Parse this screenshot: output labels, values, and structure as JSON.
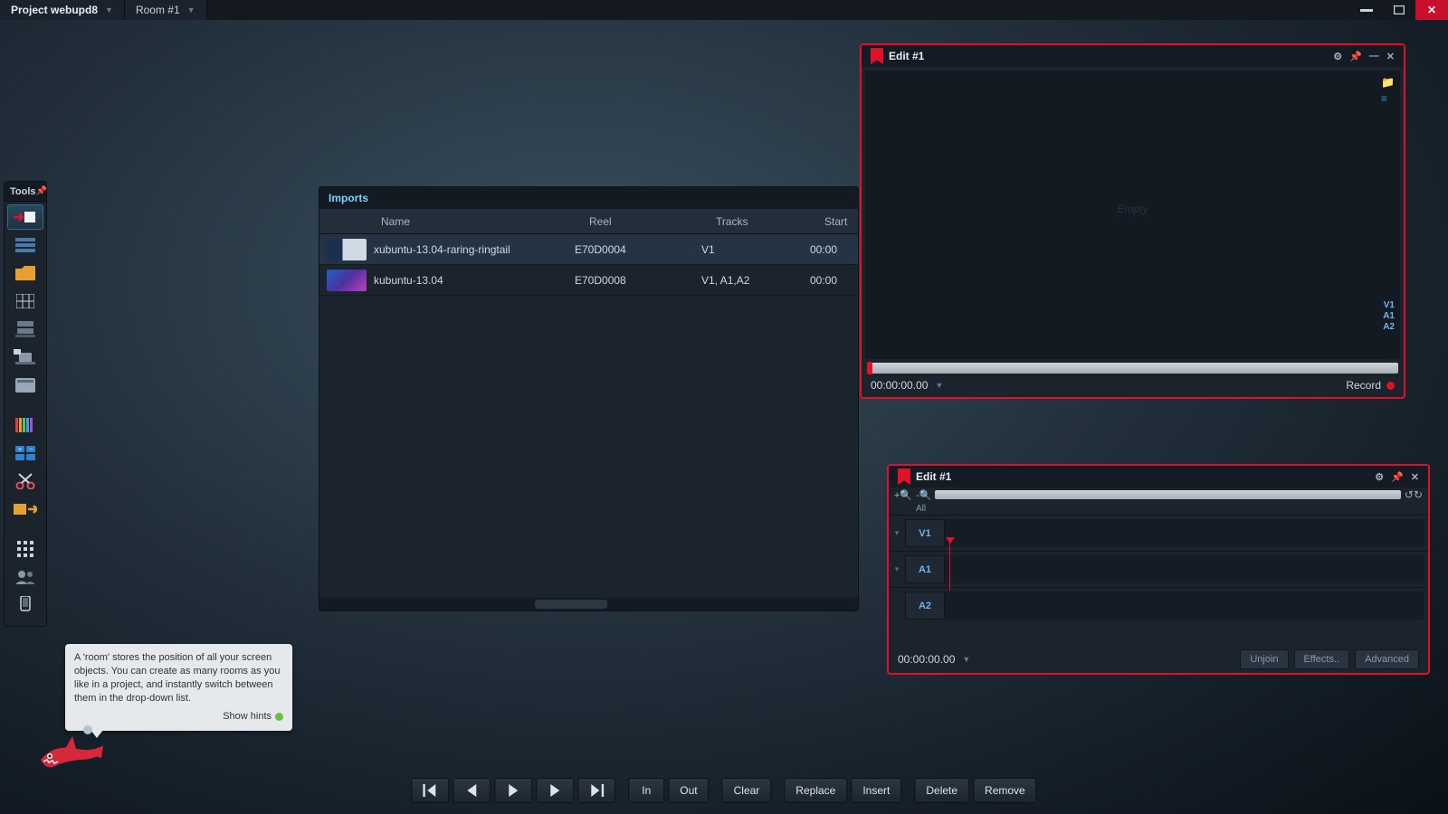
{
  "menubar": {
    "project_label": "Project webupd8",
    "room_label": "Room #1"
  },
  "tools": {
    "title": "Tools",
    "items": [
      {
        "id": "import-tool",
        "sel": true
      },
      {
        "id": "rack-tool"
      },
      {
        "id": "folder-tool"
      },
      {
        "id": "grid-tool"
      },
      {
        "id": "storage-tool"
      },
      {
        "id": "output-tool"
      },
      {
        "id": "disk-tool"
      },
      {
        "id": "scopes-tool"
      },
      {
        "id": "adjust-tool"
      },
      {
        "id": "cut-tool"
      },
      {
        "id": "export-tool"
      },
      {
        "id": "gap"
      },
      {
        "id": "apps-tool"
      },
      {
        "id": "users-tool"
      },
      {
        "id": "device-tool"
      }
    ]
  },
  "imports": {
    "title": "Imports",
    "columns": {
      "name": "Name",
      "reel": "Reel",
      "tracks": "Tracks",
      "start": "Start"
    },
    "rows": [
      {
        "name": "xubuntu-13.04-raring-ringtail",
        "reel": "E70D0004",
        "tracks": "V1",
        "start": "00:00",
        "thumb": "#2b4a6a",
        "sel": true
      },
      {
        "name": "kubuntu-13.04",
        "reel": "E70D0008",
        "tracks": "V1, A1,A2",
        "start": "00:00",
        "thumb": "linear-gradient(135deg,#2060c0,#c040c0)"
      }
    ]
  },
  "viewer": {
    "title": "Edit #1",
    "empty": "Empty",
    "timecode": "00:00:00.00",
    "record_label": "Record",
    "track_labels": [
      "V1",
      "A1",
      "A2"
    ]
  },
  "timeline": {
    "title": "Edit #1",
    "all_label": "All",
    "tracks": [
      "V1",
      "A1",
      "A2"
    ],
    "timecode": "00:00:00.00",
    "buttons": {
      "unjoin": "Unjoin",
      "effects": "Effects..",
      "advanced": "Advanced"
    }
  },
  "tooltip": {
    "text": "A 'room' stores the position of all your screen objects.  You can create as many rooms as you like in a project, and instantly switch between them in the drop-down list.",
    "show_hints": "Show hints"
  },
  "transport": {
    "in": "In",
    "out": "Out",
    "clear": "Clear",
    "replace": "Replace",
    "insert": "Insert",
    "delete": "Delete",
    "remove": "Remove"
  }
}
